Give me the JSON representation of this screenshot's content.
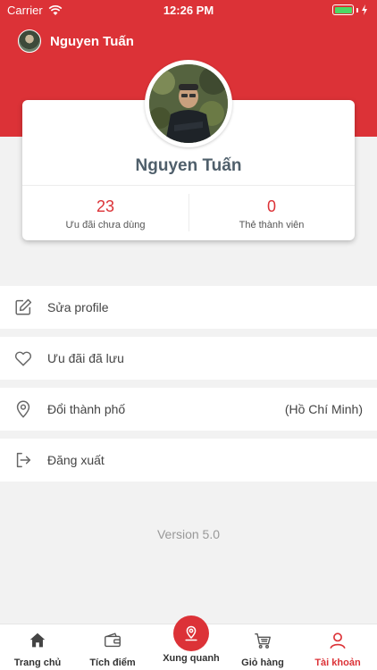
{
  "status_bar": {
    "carrier": "Carrier",
    "time": "12:26 PM"
  },
  "profile": {
    "name": "Nguyen Tuấn",
    "stats": [
      {
        "value": "23",
        "label": "Ưu đãi chưa dùng"
      },
      {
        "value": "0",
        "label": "Thẻ thành viên"
      }
    ]
  },
  "menu": [
    {
      "label": "Sửa profile",
      "icon": "edit-icon"
    },
    {
      "label": "Ưu đãi đã lưu",
      "icon": "heart-icon"
    },
    {
      "label": "Đổi thành phố",
      "value": "(Hồ Chí Minh)",
      "icon": "location-pin-icon"
    },
    {
      "label": "Đăng xuất",
      "icon": "logout-icon"
    }
  ],
  "version": "Version 5.0",
  "tabs": [
    {
      "label": "Trang chủ",
      "icon": "home-icon"
    },
    {
      "label": "Tích điểm",
      "icon": "wallet-icon"
    },
    {
      "label": "Xung quanh",
      "icon": "map-pin-icon"
    },
    {
      "label": "Giỏ hàng",
      "icon": "cart-icon"
    },
    {
      "label": "Tài khoản",
      "icon": "user-icon",
      "active": true
    }
  ],
  "colors": {
    "brand": "#dc3237",
    "battery": "#4cd964"
  }
}
